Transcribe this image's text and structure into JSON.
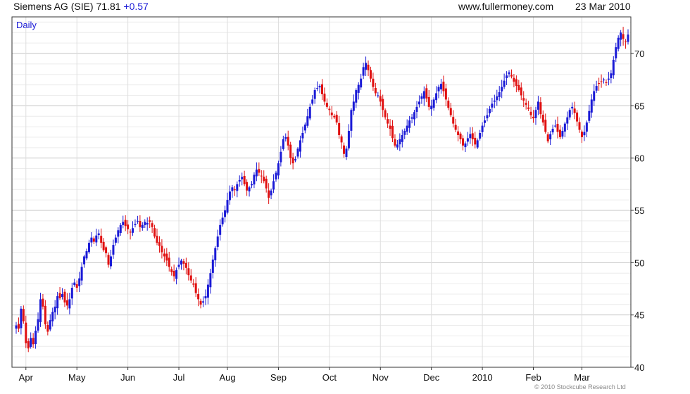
{
  "header": {
    "title": "Siemens AG (SIE) 71.81",
    "change": "+0.57",
    "site": "www.fullermoney.com",
    "date": "23 Mar 2010"
  },
  "copyright": "© 2010 Stockcube Research Ltd",
  "colors": {
    "up": "#1a1ad6",
    "down": "#e01010",
    "grid": "#dcdcdc",
    "frame": "#333333",
    "label": "#1a1ad6"
  },
  "chart_data": {
    "type": "candlestick",
    "period_label": "Daily",
    "ylim": [
      40,
      73.5
    ],
    "yticks": [
      40,
      45,
      50,
      55,
      60,
      65,
      70
    ],
    "xlim": [
      0,
      252
    ],
    "xticks": [
      {
        "label": "Apr",
        "x": 4
      },
      {
        "label": "May",
        "x": 25
      },
      {
        "label": "Jun",
        "x": 46
      },
      {
        "label": "Jul",
        "x": 67
      },
      {
        "label": "Aug",
        "x": 87
      },
      {
        "label": "Sep",
        "x": 108
      },
      {
        "label": "Oct",
        "x": 129
      },
      {
        "label": "Nov",
        "x": 150
      },
      {
        "label": "Dec",
        "x": 171
      },
      {
        "label": "2010",
        "x": 192
      },
      {
        "label": "Feb",
        "x": 213
      },
      {
        "label": "Mar",
        "x": 233
      }
    ],
    "closes": [
      44.0,
      43.7,
      45.6,
      44.4,
      42.3,
      41.8,
      42.8,
      42.2,
      43.5,
      44.6,
      46.5,
      45.8,
      44.1,
      43.4,
      44.5,
      45.3,
      45.8,
      46.8,
      46.6,
      47.0,
      46.2,
      45.9,
      46.5,
      47.6,
      48.1,
      47.6,
      48.5,
      49.6,
      50.6,
      51.1,
      51.9,
      52.4,
      52.0,
      52.6,
      52.8,
      51.9,
      51.2,
      50.9,
      49.8,
      50.6,
      51.7,
      52.4,
      53.1,
      53.6,
      53.9,
      53.5,
      53.2,
      52.9,
      53.3,
      53.7,
      54.0,
      53.4,
      53.6,
      53.9,
      53.8,
      53.9,
      53.4,
      52.5,
      51.9,
      51.6,
      51.0,
      50.6,
      50.2,
      49.6,
      49.1,
      48.7,
      49.3,
      49.8,
      50.2,
      49.9,
      49.5,
      48.8,
      48.3,
      47.9,
      47.1,
      46.5,
      46.0,
      46.3,
      46.8,
      47.9,
      49.0,
      50.3,
      51.4,
      52.5,
      53.6,
      54.3,
      55.0,
      56.0,
      56.8,
      57.2,
      57.0,
      57.5,
      57.9,
      58.2,
      57.5,
      56.9,
      57.2,
      57.5,
      58.4,
      58.9,
      58.6,
      58.3,
      57.8,
      57.1,
      56.2,
      56.9,
      57.8,
      58.6,
      59.5,
      60.6,
      61.8,
      62.0,
      61.2,
      60.0,
      59.5,
      59.9,
      60.9,
      61.7,
      62.4,
      63.2,
      64.0,
      64.9,
      65.6,
      66.5,
      66.7,
      66.9,
      66.1,
      65.4,
      64.9,
      64.6,
      64.1,
      63.9,
      63.4,
      62.2,
      61.5,
      60.4,
      60.9,
      62.6,
      64.6,
      65.4,
      66.5,
      67.0,
      67.6,
      68.7,
      69.1,
      68.4,
      67.6,
      66.8,
      66.2,
      66.0,
      65.4,
      64.6,
      63.9,
      63.3,
      62.8,
      61.9,
      61.2,
      61.3,
      61.8,
      62.2,
      62.6,
      63.1,
      63.6,
      63.9,
      64.4,
      64.9,
      65.4,
      65.9,
      66.4,
      65.7,
      64.9,
      65.0,
      65.6,
      66.2,
      66.8,
      67.1,
      66.4,
      65.6,
      64.8,
      64.1,
      63.3,
      62.7,
      62.2,
      61.8,
      61.2,
      61.4,
      61.9,
      62.3,
      61.8,
      61.3,
      61.7,
      62.4,
      63.1,
      63.6,
      64.1,
      64.7,
      65.2,
      65.5,
      65.9,
      66.3,
      66.8,
      67.4,
      67.9,
      68.2,
      67.8,
      67.3,
      66.9,
      66.5,
      66.0,
      65.5,
      65.1,
      64.7,
      64.1,
      63.8,
      64.6,
      65.4,
      64.2,
      63.4,
      62.5,
      61.6,
      62.3,
      62.8,
      63.1,
      62.5,
      62.0,
      62.6,
      63.3,
      63.9,
      64.6,
      64.9,
      64.3,
      63.5,
      62.7,
      62.0,
      62.5,
      63.4,
      64.5,
      65.6,
      66.4,
      66.9,
      67.1,
      67.3,
      67.5,
      67.2,
      67.6,
      68.1,
      69.4,
      70.6,
      71.5,
      72.0,
      71.4,
      71.1,
      71.81
    ]
  }
}
